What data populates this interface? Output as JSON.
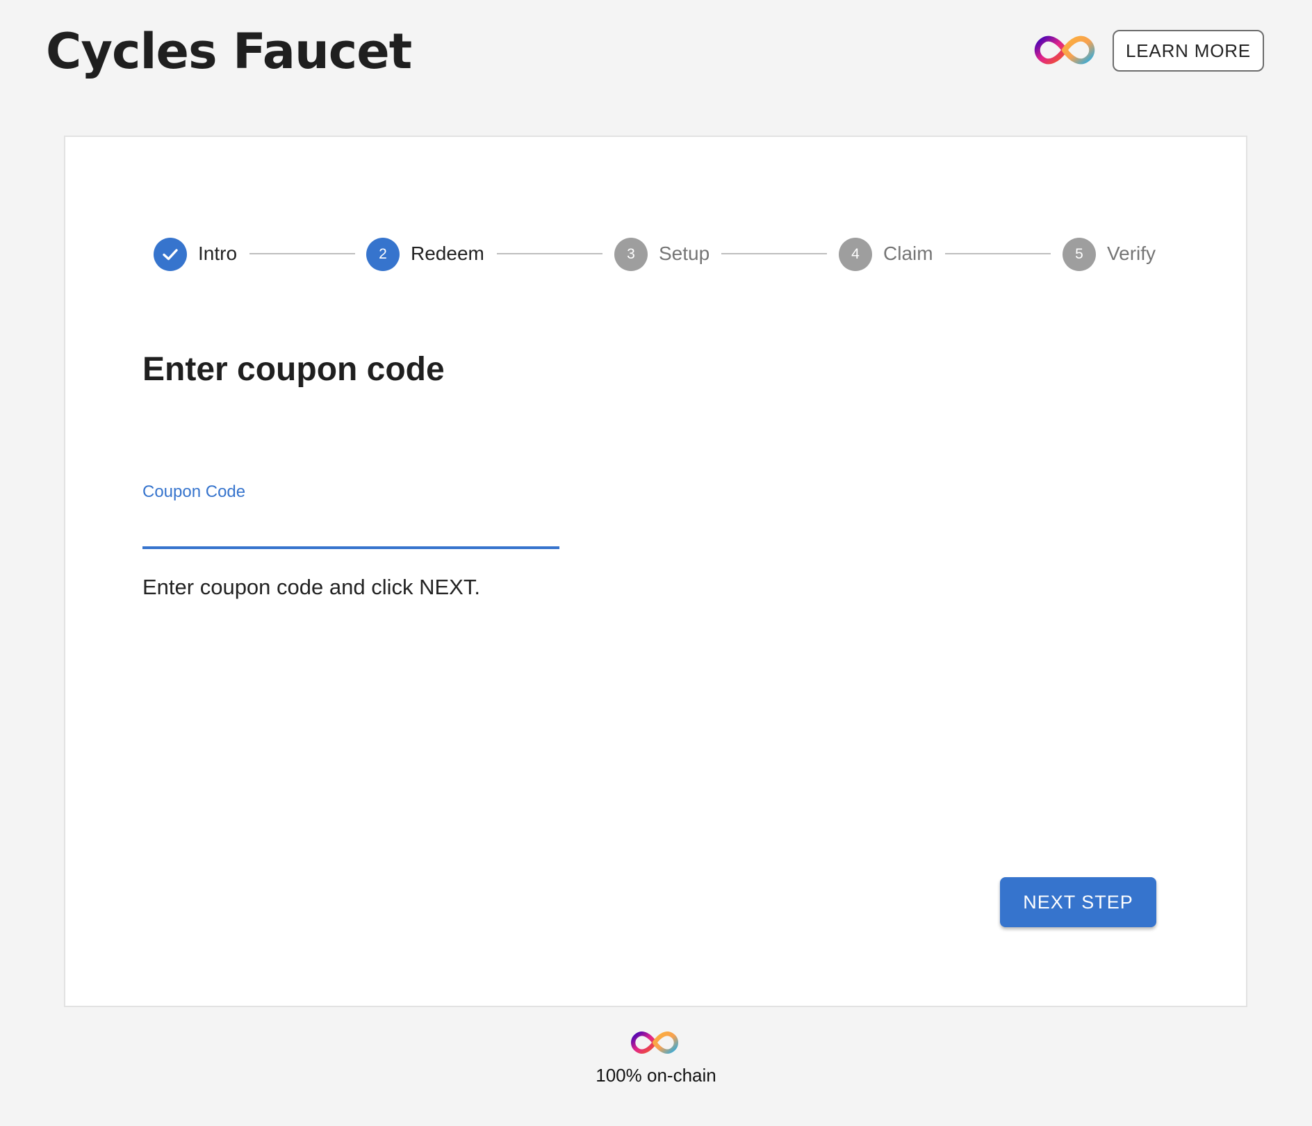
{
  "header": {
    "title": "Cycles Faucet",
    "logo_icon": "infinity-logo-icon",
    "learn_more_label": "LEARN MORE"
  },
  "stepper": {
    "steps": [
      {
        "label": "Intro",
        "number": "1",
        "state": "completed",
        "icon": "check-icon"
      },
      {
        "label": "Redeem",
        "number": "2",
        "state": "active"
      },
      {
        "label": "Setup",
        "number": "3",
        "state": "pending"
      },
      {
        "label": "Claim",
        "number": "4",
        "state": "pending"
      },
      {
        "label": "Verify",
        "number": "5",
        "state": "pending"
      }
    ]
  },
  "main": {
    "title": "Enter coupon code",
    "coupon_field": {
      "label": "Coupon Code",
      "value": "",
      "placeholder": ""
    },
    "helper_text": "Enter coupon code and click NEXT.",
    "next_button_label": "NEXT STEP"
  },
  "footer": {
    "logo_icon": "infinity-logo-icon",
    "text": "100% on-chain"
  },
  "colors": {
    "primary": "#3674cd",
    "pending": "#9e9e9e",
    "background": "#f4f4f4",
    "card": "#ffffff"
  }
}
